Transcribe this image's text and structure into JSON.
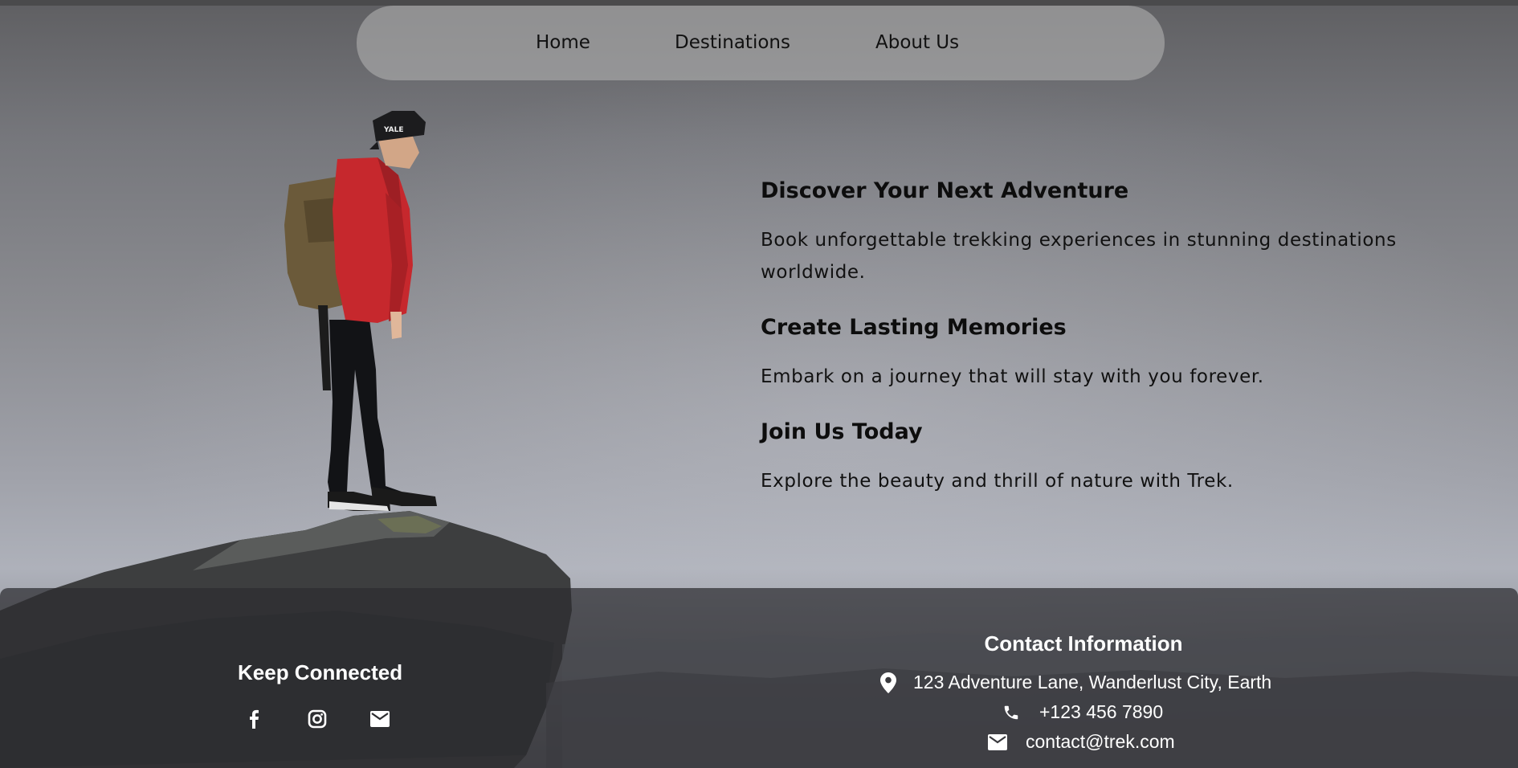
{
  "nav": {
    "items": [
      {
        "label": "Home"
      },
      {
        "label": "Destinations"
      },
      {
        "label": "About Us"
      }
    ]
  },
  "hero": {
    "sections": [
      {
        "heading": "Discover Your Next Adventure",
        "text": "Book unforgettable trekking experiences in stunning destinations worldwide."
      },
      {
        "heading": "Create Lasting Memories",
        "text": "Embark on a journey that will stay with you forever."
      },
      {
        "heading": "Join Us Today",
        "text": "Explore the beauty and thrill of nature with Trek."
      }
    ]
  },
  "footer": {
    "keep_connected": {
      "title": "Keep Connected",
      "icons": [
        "facebook-icon",
        "instagram-icon",
        "mail-icon"
      ]
    },
    "contact": {
      "title": "Contact Information",
      "address": "123 Adventure Lane, Wanderlust City, Earth",
      "phone": "+123 456 7890",
      "email": "contact@trek.com"
    }
  },
  "colors": {
    "jacket": "#c6282d",
    "footer_bg": "#2d2d30",
    "text_dark": "#111111",
    "text_light": "#ffffff"
  }
}
